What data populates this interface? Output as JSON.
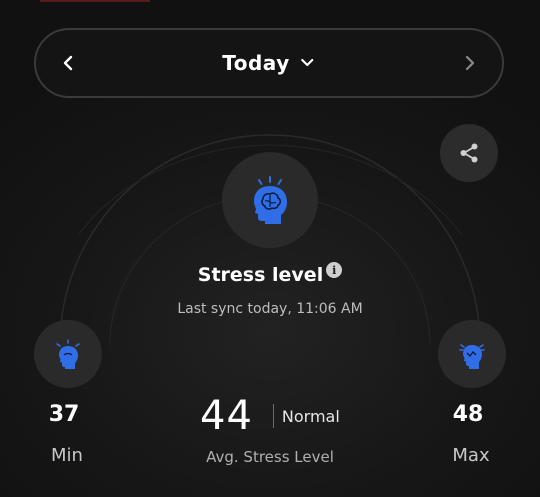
{
  "date_nav": {
    "label": "Today",
    "prev_icon": "chevron-left-icon",
    "next_icon": "chevron-right-icon",
    "dropdown_icon": "chevron-down-icon"
  },
  "share": {
    "icon": "share-icon"
  },
  "stress": {
    "title": "Stress level",
    "info_symbol": "i",
    "sync": "Last sync today, 11:06 AM",
    "icon": "brain-head-icon",
    "min_value": "37",
    "min_label": "Min",
    "max_value": "48",
    "max_label": "Max",
    "avg_value": "44",
    "avg_status": "Normal",
    "avg_label": "Avg. Stress Level"
  },
  "colors": {
    "accent": "#2f6ee6",
    "background": "#121212",
    "circle": "#2a2a2a"
  }
}
